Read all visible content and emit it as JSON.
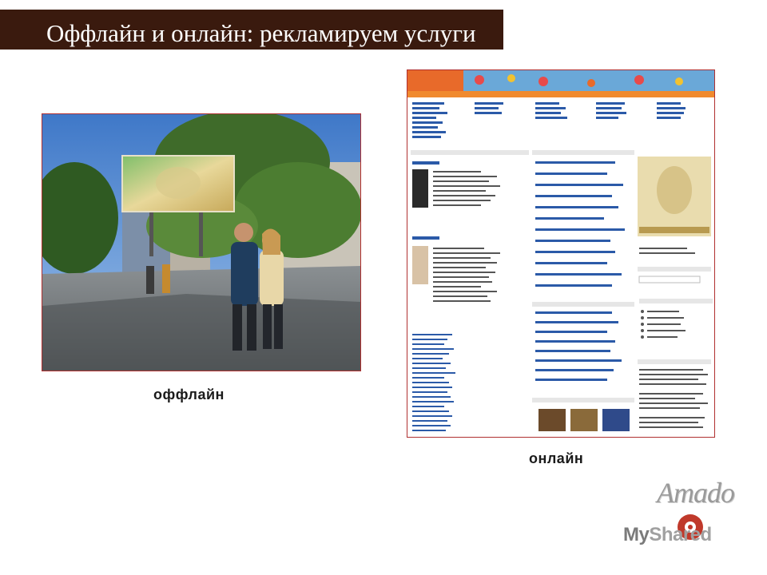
{
  "slide": {
    "title": "Оффлайн и онлайн: рекламируем услуги",
    "caption_offline": "оффлайн",
    "caption_online": "онлайн"
  },
  "logos": {
    "amado": "Amado",
    "myshared_my": "My",
    "myshared_shared": "Shared"
  },
  "colors": {
    "title_bar": "#3a1a0e",
    "frame_border": "#b03030"
  }
}
